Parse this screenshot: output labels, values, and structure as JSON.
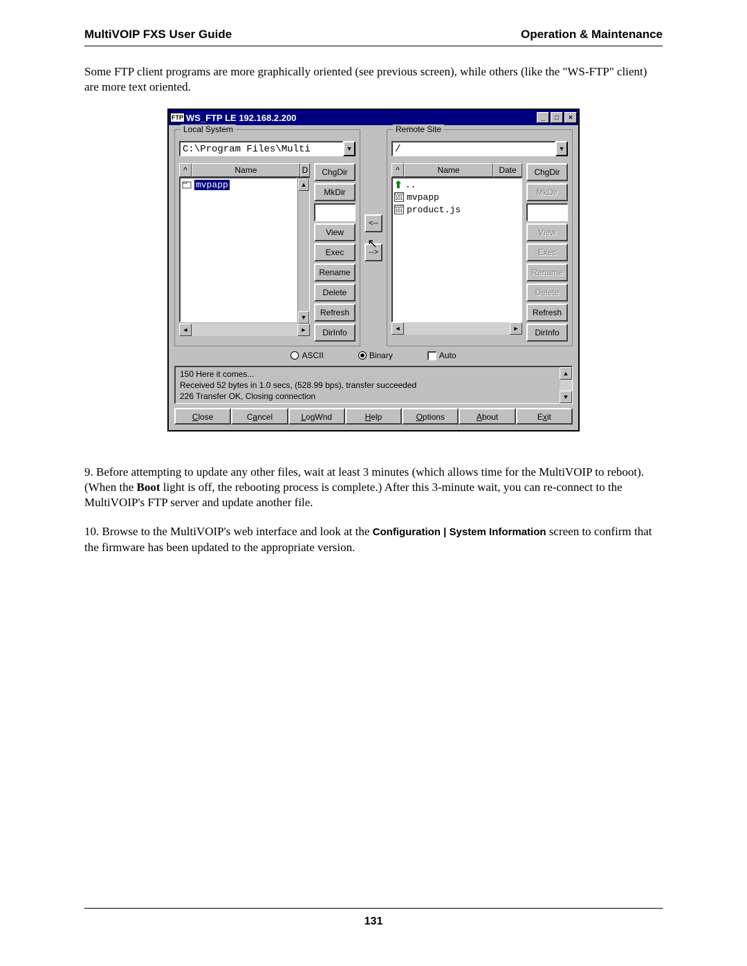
{
  "header": {
    "left": "MultiVOIP FXS User Guide",
    "right": "Operation & Maintenance"
  },
  "intro_text": "Some FTP client programs are more graphically oriented (see previous screen), while others (like the \"WS-FTP\" client) are more text oriented.",
  "window": {
    "title": "WS_FTP LE 192.168.2.200",
    "ftp_badge": "FTP",
    "local_label": "Local System",
    "remote_label": "Remote Site",
    "local_path": "C:\\Program Files\\Multi",
    "remote_path": "/",
    "col_name": "Name",
    "col_date": "Date",
    "local_files": [
      {
        "name": "mvpapp",
        "selected": true
      }
    ],
    "remote_files": [
      {
        "name": "..",
        "icon": "up"
      },
      {
        "name": "mvpapp",
        "icon": "bin"
      },
      {
        "name": "product.js",
        "icon": "bin"
      }
    ],
    "btns": {
      "chgdir": "ChgDir",
      "mkdir": "MkDir",
      "view": "View",
      "exec": "Exec",
      "rename": "Rename",
      "delete": "Delete",
      "refresh": "Refresh",
      "dirinfo": "DirInfo"
    },
    "transfer": {
      "left": "<--",
      "right": "-->"
    },
    "mode": {
      "ascii": "ASCII",
      "binary": "Binary",
      "auto": "Auto"
    },
    "log": {
      "l1": "150 Here it comes...",
      "l2": "Received 52 bytes in 1.0 secs, (528.99 bps), transfer succeeded",
      "l3": "226 Transfer OK, Closing connection"
    },
    "bottom": {
      "close": "Close",
      "cancel": "Cancel",
      "logwnd": "LogWnd",
      "help": "Help",
      "options": "Options",
      "about": "About",
      "exit": "Exit"
    }
  },
  "para9_a": "9. Before attempting to update any other files, wait at least 3 minutes (which allows time for the MultiVOIP to reboot).  (When the ",
  "para9_bold": "Boot",
  "para9_b": " light is off, the rebooting process is complete.)  After this 3-minute wait, you can re-connect to the MultiVOIP's FTP server and update another file.",
  "para10_a": "10. Browse to the MultiVOIP's web interface and look at the ",
  "para10_bold": "Configuration | System Information",
  "para10_b": " screen to confirm that the firmware has been updated to the appropriate version.",
  "page_number": "131"
}
